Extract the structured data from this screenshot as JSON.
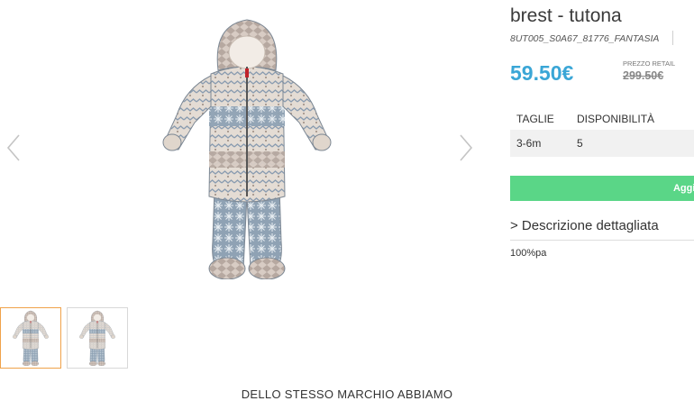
{
  "product": {
    "title": "brest - tutona",
    "sku": "8UT005_S0A67_81776_FANTASIA",
    "price": "59.50€",
    "retail_label": "PREZZO RETAIL",
    "retail_price": "299.50€"
  },
  "sizes": {
    "headers": [
      "TAGLIE",
      "DISPONIBILITÀ"
    ],
    "rows": [
      {
        "size": "3-6m",
        "availability": "5"
      }
    ]
  },
  "cart": {
    "add_label": "Aggiungi al c"
  },
  "description": {
    "toggle_label": "> Descrizione dettagliata",
    "content": "100%pa"
  },
  "related": {
    "heading": "DELLO STESSO MARCHIO ABBIAMO"
  },
  "gallery": {
    "prev_icon": "chevron-left-icon",
    "next_icon": "chevron-right-icon",
    "thumbnail_count": 2,
    "active_thumbnail": 1
  },
  "colors": {
    "price": "#3aa6d6",
    "add_button": "#5ad687",
    "active_thumb_border": "#f0a24a"
  }
}
